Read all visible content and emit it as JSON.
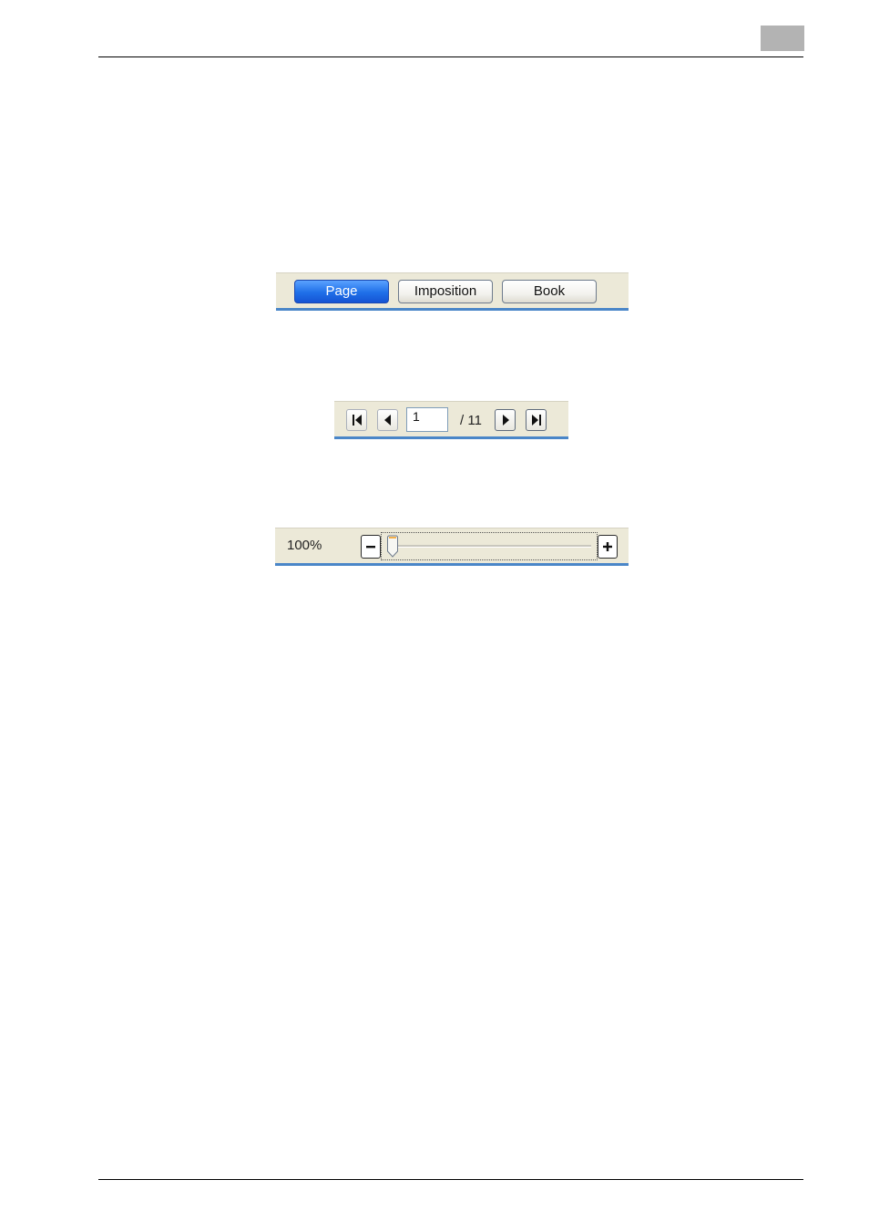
{
  "view_toolbar": {
    "buttons": [
      {
        "label": "Page",
        "active": true
      },
      {
        "label": "Imposition",
        "active": false
      },
      {
        "label": "Book",
        "active": false
      }
    ]
  },
  "page_navigation": {
    "current_page": "1",
    "total_label": "/ 11",
    "icons": [
      "first-page-icon",
      "previous-page-icon",
      "next-page-icon",
      "last-page-icon"
    ]
  },
  "zoom_toolbar": {
    "zoom_label": "100%",
    "slider_fraction": 0.0,
    "icons": [
      "zoom-out-icon",
      "zoom-in-icon"
    ]
  },
  "colors": {
    "toolbar_bg": "#ece9d8",
    "toolbar_underline": "#4a86c8",
    "active_button": "#1f6fe8",
    "chapter_tab": "#b3b3b3"
  }
}
